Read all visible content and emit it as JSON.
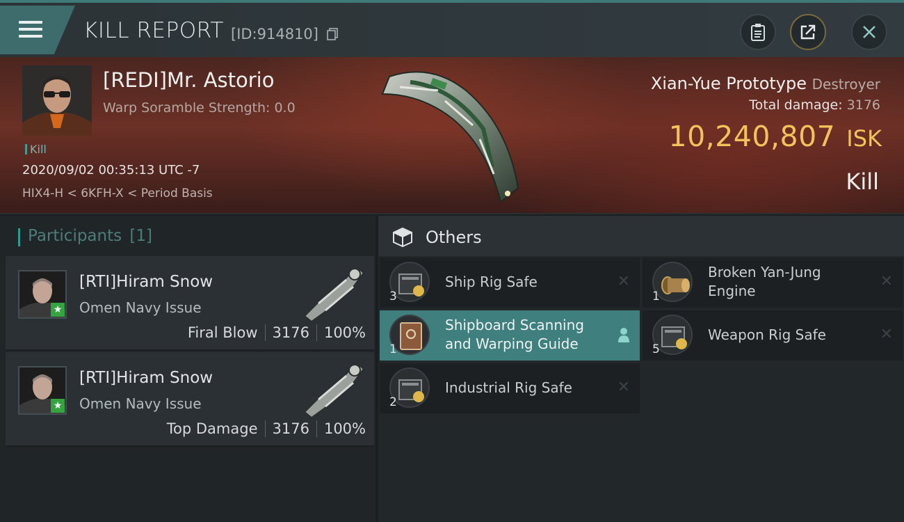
{
  "header": {
    "title": "KILL REPORT",
    "id": "[ID:914810]",
    "icons": [
      "menu-icon",
      "copy-icon",
      "clipboard-icon",
      "share-icon",
      "close-icon"
    ]
  },
  "victim": {
    "name": "[REDI]Mr. Astorio",
    "warp": "Warp Soramble Strength: 0.0",
    "tag": "Kill",
    "timestamp": "2020/09/02 00:35:13 UTC -7",
    "location": "HIX4-H < 6KFH-X < Period Basis",
    "ship": "Xian-Yue Prototype",
    "ship_class": "Destroyer",
    "damage_label": "Total damage:",
    "damage_value": "3176",
    "isk_value": "10,240,807",
    "isk_unit": "ISK",
    "result": "Kill"
  },
  "participants": {
    "title": "Participants",
    "count": "[1]",
    "rows": [
      {
        "name": "[RTI]Hiram Snow",
        "ship": "Omen Navy Issue",
        "role": "Firal Blow",
        "damage": "3176",
        "percent": "100%"
      },
      {
        "name": "[RTI]Hiram Snow",
        "ship": "Omen Navy Issue",
        "role": "Top Damage",
        "damage": "3176",
        "percent": "100%"
      }
    ]
  },
  "others": {
    "title": "Others",
    "items": [
      {
        "qty": "3",
        "name1": "Ship Rig Safe",
        "name2": ""
      },
      {
        "qty": "1",
        "name1": "Broken Yan-Jung",
        "name2": "Engine"
      },
      {
        "qty": "1",
        "name1": "Shipboard Scanning",
        "name2": "and Warping Guide"
      },
      {
        "qty": "5",
        "name1": "Weapon Rig Safe",
        "name2": ""
      },
      {
        "qty": "2",
        "name1": "Industrial Rig Safe",
        "name2": ""
      }
    ]
  },
  "colors": {
    "accent": "#3f7f7d",
    "isk": "#f2c35b",
    "banner": "#6b3026"
  }
}
